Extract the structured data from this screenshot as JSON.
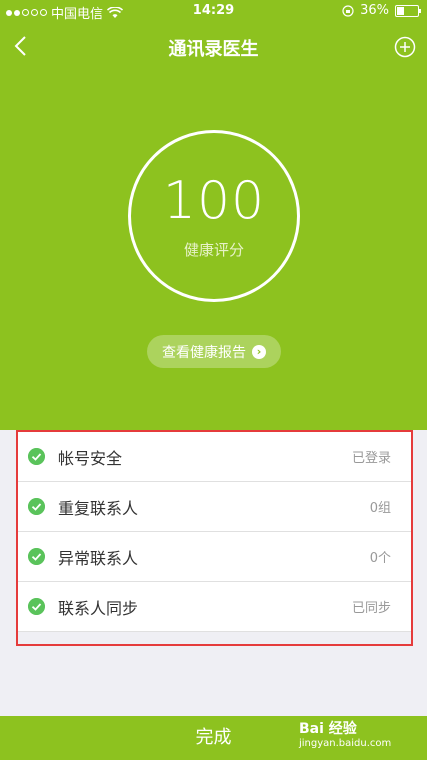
{
  "status": {
    "carrier": "中国电信",
    "time": "14:29",
    "battery": "36%"
  },
  "nav": {
    "title": "通讯录医生"
  },
  "score": {
    "value": "100",
    "label": "健康评分"
  },
  "report_button": "查看健康报告",
  "checks": [
    {
      "label": "帐号安全",
      "value": "已登录"
    },
    {
      "label": "重复联系人",
      "value": "0组"
    },
    {
      "label": "异常联系人",
      "value": "0个"
    },
    {
      "label": "联系人同步",
      "value": "已同步"
    }
  ],
  "footer": {
    "done": "完成"
  },
  "watermark": {
    "brand": "Bai 经验",
    "url": "jingyan.baidu.com"
  },
  "colors": {
    "brand_green": "#8dc21f",
    "check_green": "#5ac35b",
    "highlight_red": "#e53b3b"
  }
}
